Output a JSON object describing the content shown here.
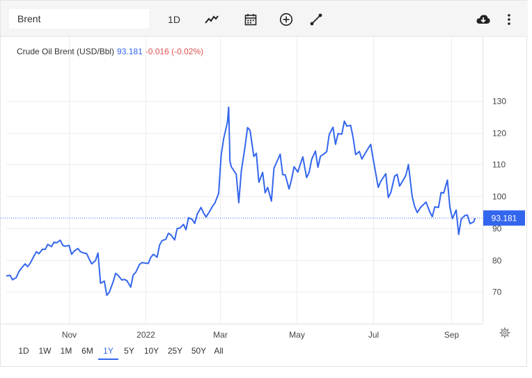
{
  "toolbar": {
    "search_value": "Brent",
    "interval_label": "1D",
    "icons": [
      "line-style-icon",
      "calendar-icon",
      "add-compare-icon",
      "draw-line-icon",
      "download-icon",
      "more-menu-icon"
    ]
  },
  "legend": {
    "name": "Crude Oil Brent (USD/Bbl)",
    "value": "93.181",
    "change": "-0.016 (-0.02%)"
  },
  "ranges": [
    "1D",
    "1W",
    "1M",
    "6M",
    "1Y",
    "5Y",
    "10Y",
    "25Y",
    "50Y",
    "All"
  ],
  "active_range": "1Y",
  "colors": {
    "line": "#3366ee",
    "change_negative": "#e05050",
    "price_tag": "#3366ee"
  },
  "chart_data": {
    "type": "line",
    "title": "",
    "xlabel": "",
    "ylabel": "",
    "ylim": [
      60,
      140
    ],
    "y_ticks": [
      70,
      80,
      90,
      100,
      110,
      120,
      130
    ],
    "x_tick_labels": [
      "Nov",
      "2022",
      "Mar",
      "May",
      "Jul",
      "Sep"
    ],
    "x_tick_dates": [
      "2021-11-01",
      "2022-01-01",
      "2022-03-01",
      "2022-05-01",
      "2022-07-01",
      "2022-09-01"
    ],
    "xlim": [
      "2021-09-12",
      "2022-09-26"
    ],
    "last_value_label": "93.181",
    "grid": true,
    "series": [
      {
        "name": "Crude Oil Brent (USD/Bbl)",
        "points": [
          [
            "2021-09-12",
            75.0
          ],
          [
            "2021-09-15",
            75.2
          ],
          [
            "2021-09-17",
            73.8
          ],
          [
            "2021-09-20",
            74.5
          ],
          [
            "2021-09-22",
            76.3
          ],
          [
            "2021-09-24",
            77.4
          ],
          [
            "2021-09-27",
            78.8
          ],
          [
            "2021-09-29",
            77.9
          ],
          [
            "2021-10-01",
            79.0
          ],
          [
            "2021-10-04",
            81.2
          ],
          [
            "2021-10-06",
            82.6
          ],
          [
            "2021-10-08",
            82.0
          ],
          [
            "2021-10-11",
            83.4
          ],
          [
            "2021-10-13",
            83.3
          ],
          [
            "2021-10-15",
            84.9
          ],
          [
            "2021-10-18",
            84.2
          ],
          [
            "2021-10-20",
            85.6
          ],
          [
            "2021-10-22",
            85.4
          ],
          [
            "2021-10-25",
            86.2
          ],
          [
            "2021-10-27",
            84.6
          ],
          [
            "2021-10-29",
            84.3
          ],
          [
            "2021-11-01",
            84.6
          ],
          [
            "2021-11-03",
            81.8
          ],
          [
            "2021-11-05",
            82.8
          ],
          [
            "2021-11-08",
            83.6
          ],
          [
            "2021-11-10",
            82.6
          ],
          [
            "2021-11-12",
            82.3
          ],
          [
            "2021-11-15",
            82.0
          ],
          [
            "2021-11-17",
            80.3
          ],
          [
            "2021-11-19",
            78.8
          ],
          [
            "2021-11-22",
            79.8
          ],
          [
            "2021-11-24",
            82.2
          ],
          [
            "2021-11-26",
            72.7
          ],
          [
            "2021-11-29",
            73.4
          ],
          [
            "2021-12-01",
            68.9
          ],
          [
            "2021-12-03",
            69.9
          ],
          [
            "2021-12-06",
            73.1
          ],
          [
            "2021-12-08",
            75.8
          ],
          [
            "2021-12-10",
            75.2
          ],
          [
            "2021-12-13",
            73.7
          ],
          [
            "2021-12-15",
            73.9
          ],
          [
            "2021-12-17",
            73.5
          ],
          [
            "2021-12-20",
            71.5
          ],
          [
            "2021-12-22",
            75.3
          ],
          [
            "2021-12-24",
            76.1
          ],
          [
            "2021-12-27",
            78.6
          ],
          [
            "2021-12-29",
            79.2
          ],
          [
            "2022-01-03",
            78.9
          ],
          [
            "2022-01-05",
            80.8
          ],
          [
            "2022-01-07",
            81.8
          ],
          [
            "2022-01-10",
            80.9
          ],
          [
            "2022-01-12",
            84.7
          ],
          [
            "2022-01-14",
            86.1
          ],
          [
            "2022-01-17",
            86.5
          ],
          [
            "2022-01-19",
            88.4
          ],
          [
            "2022-01-21",
            87.9
          ],
          [
            "2022-01-24",
            86.3
          ],
          [
            "2022-01-26",
            89.9
          ],
          [
            "2022-01-28",
            90.0
          ],
          [
            "2022-01-31",
            91.2
          ],
          [
            "2022-02-02",
            89.5
          ],
          [
            "2022-02-04",
            93.3
          ],
          [
            "2022-02-07",
            92.7
          ],
          [
            "2022-02-09",
            91.5
          ],
          [
            "2022-02-11",
            94.4
          ],
          [
            "2022-02-14",
            96.5
          ],
          [
            "2022-02-16",
            94.8
          ],
          [
            "2022-02-18",
            93.5
          ],
          [
            "2022-02-21",
            95.4
          ],
          [
            "2022-02-23",
            96.8
          ],
          [
            "2022-02-25",
            97.9
          ],
          [
            "2022-02-28",
            100.9
          ],
          [
            "2022-03-02",
            112.9
          ],
          [
            "2022-03-04",
            118.1
          ],
          [
            "2022-03-07",
            123.2
          ],
          [
            "2022-03-08",
            127.98
          ],
          [
            "2022-03-09",
            111.1
          ],
          [
            "2022-03-10",
            109.3
          ],
          [
            "2022-03-14",
            106.9
          ],
          [
            "2022-03-16",
            98.0
          ],
          [
            "2022-03-18",
            107.9
          ],
          [
            "2022-03-21",
            115.6
          ],
          [
            "2022-03-23",
            121.6
          ],
          [
            "2022-03-25",
            120.7
          ],
          [
            "2022-03-28",
            112.5
          ],
          [
            "2022-03-30",
            113.5
          ],
          [
            "2022-04-01",
            104.4
          ],
          [
            "2022-04-04",
            107.5
          ],
          [
            "2022-04-06",
            101.1
          ],
          [
            "2022-04-08",
            102.8
          ],
          [
            "2022-04-11",
            98.5
          ],
          [
            "2022-04-13",
            108.8
          ],
          [
            "2022-04-18",
            113.2
          ],
          [
            "2022-04-20",
            106.8
          ],
          [
            "2022-04-22",
            106.7
          ],
          [
            "2022-04-25",
            102.3
          ],
          [
            "2022-04-27",
            105.3
          ],
          [
            "2022-04-29",
            109.3
          ],
          [
            "2022-05-02",
            107.6
          ],
          [
            "2022-05-04",
            110.1
          ],
          [
            "2022-05-06",
            112.4
          ],
          [
            "2022-05-09",
            105.9
          ],
          [
            "2022-05-11",
            107.5
          ],
          [
            "2022-05-13",
            111.6
          ],
          [
            "2022-05-16",
            114.2
          ],
          [
            "2022-05-18",
            109.1
          ],
          [
            "2022-05-20",
            112.6
          ],
          [
            "2022-05-23",
            113.4
          ],
          [
            "2022-05-25",
            114.0
          ],
          [
            "2022-05-27",
            119.4
          ],
          [
            "2022-05-30",
            121.7
          ],
          [
            "2022-06-01",
            116.3
          ],
          [
            "2022-06-03",
            119.7
          ],
          [
            "2022-06-06",
            119.5
          ],
          [
            "2022-06-08",
            123.6
          ],
          [
            "2022-06-10",
            122.0
          ],
          [
            "2022-06-13",
            122.3
          ],
          [
            "2022-06-15",
            118.5
          ],
          [
            "2022-06-17",
            113.1
          ],
          [
            "2022-06-20",
            114.1
          ],
          [
            "2022-06-22",
            111.7
          ],
          [
            "2022-06-24",
            113.1
          ],
          [
            "2022-06-27",
            115.1
          ],
          [
            "2022-06-29",
            116.3
          ],
          [
            "2022-07-01",
            111.6
          ],
          [
            "2022-07-05",
            102.8
          ],
          [
            "2022-07-07",
            104.7
          ],
          [
            "2022-07-11",
            107.1
          ],
          [
            "2022-07-13",
            99.6
          ],
          [
            "2022-07-15",
            101.2
          ],
          [
            "2022-07-18",
            106.3
          ],
          [
            "2022-07-20",
            106.9
          ],
          [
            "2022-07-22",
            103.2
          ],
          [
            "2022-07-25",
            105.2
          ],
          [
            "2022-07-27",
            106.6
          ],
          [
            "2022-07-29",
            110.0
          ],
          [
            "2022-08-01",
            100.0
          ],
          [
            "2022-08-03",
            96.8
          ],
          [
            "2022-08-05",
            94.9
          ],
          [
            "2022-08-08",
            96.7
          ],
          [
            "2022-08-10",
            97.4
          ],
          [
            "2022-08-12",
            98.2
          ],
          [
            "2022-08-15",
            95.1
          ],
          [
            "2022-08-17",
            93.6
          ],
          [
            "2022-08-19",
            96.7
          ],
          [
            "2022-08-22",
            96.5
          ],
          [
            "2022-08-24",
            101.2
          ],
          [
            "2022-08-26",
            100.99
          ],
          [
            "2022-08-29",
            105.1
          ],
          [
            "2022-08-31",
            96.5
          ],
          [
            "2022-09-02",
            93.0
          ],
          [
            "2022-09-05",
            95.7
          ],
          [
            "2022-09-07",
            88.0
          ],
          [
            "2022-09-09",
            92.8
          ],
          [
            "2022-09-12",
            94.0
          ],
          [
            "2022-09-14",
            94.1
          ],
          [
            "2022-09-16",
            91.4
          ],
          [
            "2022-09-19",
            92.0
          ],
          [
            "2022-09-20",
            93.181
          ]
        ]
      }
    ]
  }
}
